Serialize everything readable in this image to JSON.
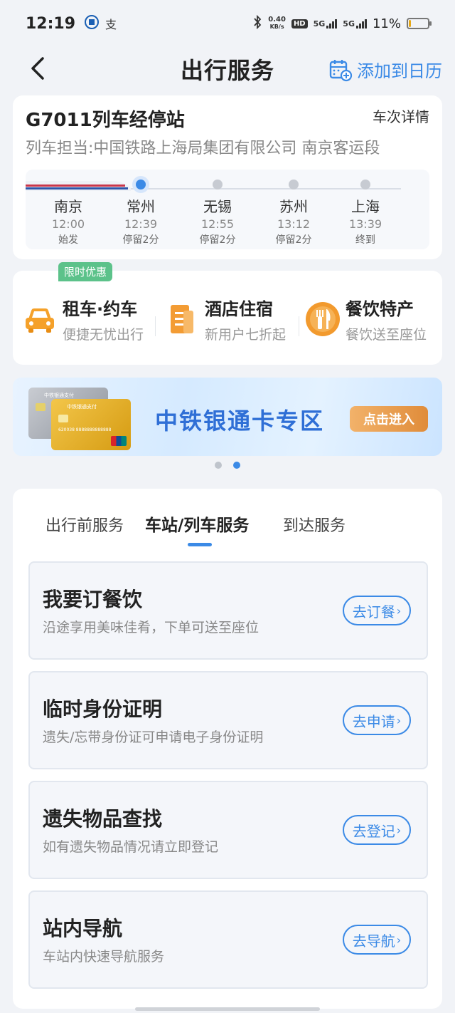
{
  "status_bar": {
    "time": "12:19",
    "app_icon_1": "12306-icon",
    "app_icon_2": "支",
    "net_speed_value": "0.40",
    "net_speed_unit": "KB/s",
    "hd": "HD",
    "signal_1": "5G",
    "signal_2": "5G",
    "battery": "11%",
    "battery_level": 0.11
  },
  "nav": {
    "title": "出行服务",
    "add_calendar": "添加到日历"
  },
  "train": {
    "title": "G7011列车经停站",
    "detail_link": "车次详情",
    "operator": "列车担当:中国铁路上海局集团有限公司 南京客运段",
    "stops": [
      {
        "name": "南京",
        "time": "12:00",
        "info": "始发"
      },
      {
        "name": "常州",
        "time": "12:39",
        "info": "停留2分"
      },
      {
        "name": "无锡",
        "time": "12:55",
        "info": "停留2分"
      },
      {
        "name": "苏州",
        "time": "13:12",
        "info": "停留2分"
      },
      {
        "name": "上海",
        "time": "13:39",
        "info": "终到"
      }
    ],
    "current_stop_index": 1
  },
  "services": [
    {
      "title": "租车·约车",
      "desc": "便捷无忧出行",
      "icon": "taxi-icon",
      "badge": "限时优惠"
    },
    {
      "title": "酒店住宿",
      "desc": "新用户七折起",
      "icon": "hotel-icon"
    },
    {
      "title": "餐饮特产",
      "desc": "餐饮送至座位",
      "icon": "dining-icon"
    }
  ],
  "banner": {
    "text": "中铁银通卡专区",
    "button": "点击进入",
    "card_label": "中铁银通支付",
    "card_number": "620038 8888888888888"
  },
  "carousel": {
    "count": 2,
    "active": 1
  },
  "tabs": {
    "items": [
      "出行前服务",
      "车站/列车服务",
      "到达服务"
    ],
    "active_index": 1
  },
  "items": [
    {
      "title": "我要订餐饮",
      "desc": "沿途享用美味佳肴，下单可送至座位",
      "button": "去订餐"
    },
    {
      "title": "临时身份证明",
      "desc": "遗失/忘带身份证可申请电子身份证明",
      "button": "去申请"
    },
    {
      "title": "遗失物品查找",
      "desc": "如有遗失物品情况请立即登记",
      "button": "去登记"
    },
    {
      "title": "站内导航",
      "desc": "车站内快速导航服务",
      "button": "去导航"
    }
  ],
  "colors": {
    "accent": "#3b8ae6",
    "badge_green": "#5cc28a",
    "taxi_orange": "#f5a12a",
    "hotel_orange": "#f39c34",
    "dining_orange": "#f29a2e"
  }
}
